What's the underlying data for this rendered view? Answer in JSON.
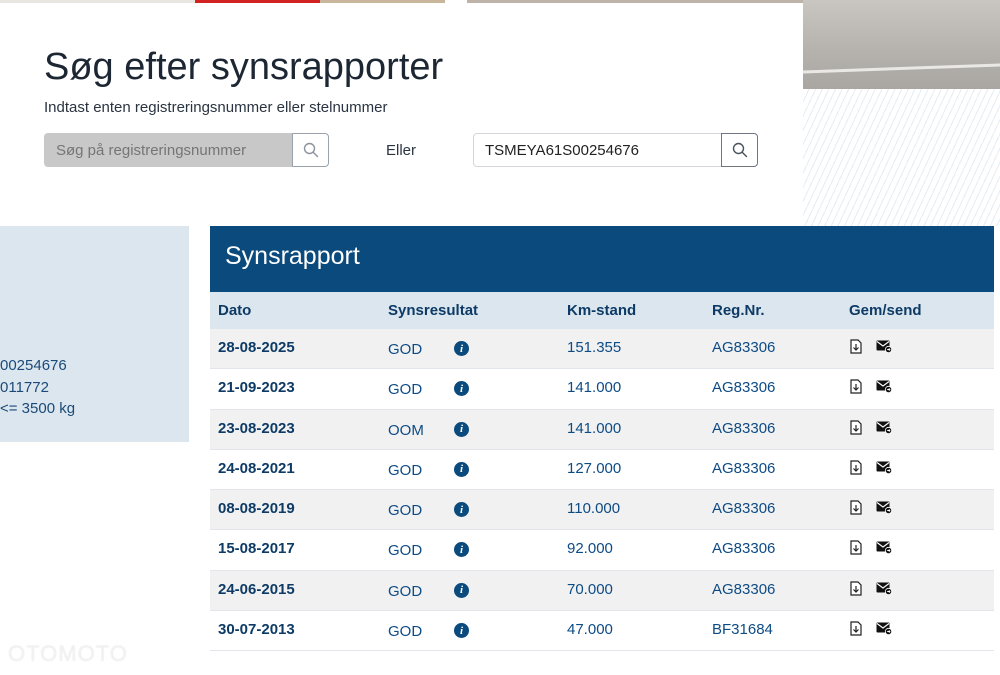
{
  "search": {
    "title": "Søg efter synsrapporter",
    "subtitle": "Indtast enten registreringsnummer eller stelnummer",
    "reg_placeholder": "Søg på registreringsnummer",
    "or_label": "Eller",
    "vin_value": "TSMEYA61S00254676"
  },
  "vehicle_info": {
    "lines": [
      "00254676",
      "011772",
      "<= 3500 kg"
    ]
  },
  "report": {
    "title": "Synsrapport",
    "columns": {
      "date": "Dato",
      "result": "Synsresultat",
      "km": "Km-stand",
      "reg": "Reg.Nr.",
      "save_send": "Gem/send"
    },
    "rows": [
      {
        "date": "28-08-2025",
        "result": "GOD",
        "km": "151.355",
        "reg": "AG83306"
      },
      {
        "date": "21-09-2023",
        "result": "GOD",
        "km": "141.000",
        "reg": "AG83306"
      },
      {
        "date": "23-08-2023",
        "result": "OOM",
        "km": "141.000",
        "reg": "AG83306"
      },
      {
        "date": "24-08-2021",
        "result": "GOD",
        "km": "127.000",
        "reg": "AG83306"
      },
      {
        "date": "08-08-2019",
        "result": "GOD",
        "km": "110.000",
        "reg": "AG83306"
      },
      {
        "date": "15-08-2017",
        "result": "GOD",
        "km": "92.000",
        "reg": "AG83306"
      },
      {
        "date": "24-06-2015",
        "result": "GOD",
        "km": "70.000",
        "reg": "AG83306"
      },
      {
        "date": "30-07-2013",
        "result": "GOD",
        "km": "47.000",
        "reg": "BF31684"
      }
    ],
    "info_glyph": "i"
  },
  "icons": {
    "search": "search-icon",
    "info": "info-icon",
    "download": "download-file-icon",
    "mail": "send-mail-icon"
  },
  "colors": {
    "header_blue": "#0b4a7d",
    "text_blue": "#0d3b66",
    "panel_blue": "#dce6ee"
  },
  "watermark": "OTOMOTO"
}
